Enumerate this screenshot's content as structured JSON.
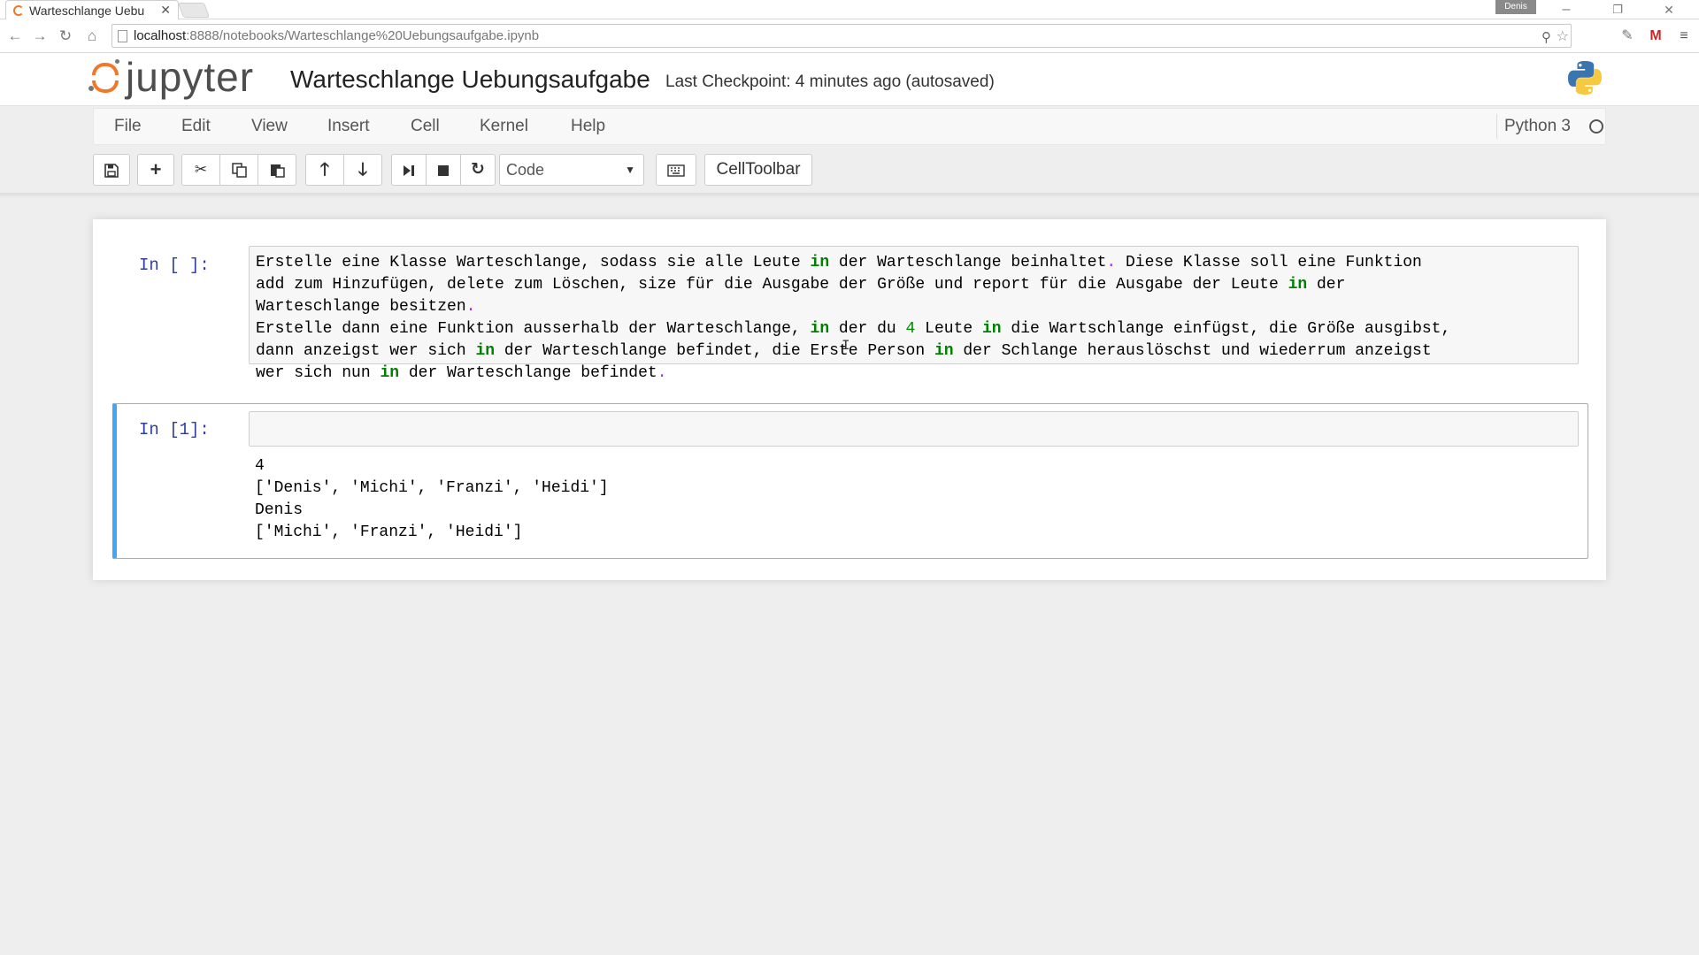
{
  "browser": {
    "tab_title": "Warteschlange Uebu",
    "user_badge": "Denis",
    "url_host": "localhost",
    "url_rest": ":8888/notebooks/Warteschlange%20Uebungsaufgabe.ipynb",
    "window_controls": [
      "–",
      "❐",
      "✕"
    ]
  },
  "jupyter": {
    "logo_text": "jupyter",
    "notebook_title": "Warteschlange Uebungsaufgabe",
    "checkpoint": "Last Checkpoint: 4 minutes ago (autosaved)"
  },
  "menu": {
    "items": [
      "File",
      "Edit",
      "View",
      "Insert",
      "Cell",
      "Kernel",
      "Help"
    ],
    "kernel_name": "Python 3"
  },
  "toolbar": {
    "cell_type": "Code",
    "celltoolbar_label": "CellToolbar",
    "icons": [
      "save-icon",
      "plus-icon",
      "cut-icon",
      "copy-icon",
      "paste-icon",
      "arrow-up-icon",
      "arrow-down-icon",
      "step-forward-icon",
      "stop-icon",
      "restart-icon",
      "keyboard-icon"
    ]
  },
  "cells": [
    {
      "prompt": "In [ ]:",
      "lines": [
        "Erstelle eine Klasse Warteschlange, sodass sie alle Leute in der Warteschlange beinhaltet. Diese Klasse soll eine Funktion",
        "add zum Hinzufügen, delete zum Löschen, size für die Ausgabe der Größe und report für die Ausgabe der Leute in der",
        "Warteschlange besitzen.",
        "Erstelle dann eine Funktion ausserhalb der Warteschlange, in der du 4 Leute in die Wartschlange einfügst, die Größe ausgibst,",
        "dann anzeigst wer sich in der Warteschlange befindet, die Erste Person in der Schlange herauslöschst und wiederrum anzeigst",
        "wer sich nun in der Warteschlange befindet."
      ]
    },
    {
      "prompt": "In [1]:",
      "input": "",
      "output": [
        "4",
        "['Denis', 'Michi', 'Franzi', 'Heidi']",
        "Denis",
        "['Michi', 'Franzi', 'Heidi']"
      ]
    }
  ],
  "colors": {
    "accent_selected": "#42a5f5",
    "prompt": "#303f9f",
    "keyword": "#008000",
    "jupyter_orange": "#f37726"
  }
}
